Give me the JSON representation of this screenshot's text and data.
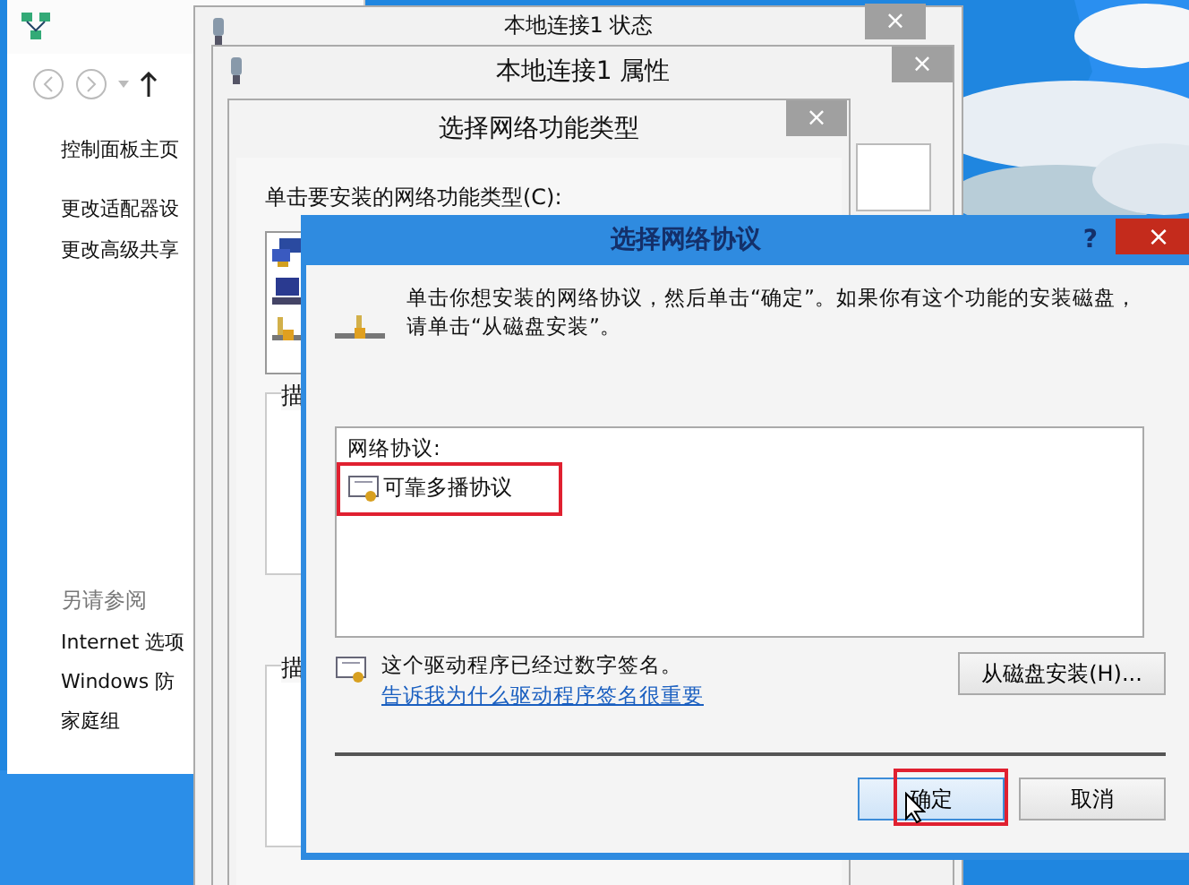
{
  "control_panel": {
    "nav": [
      {
        "kind": "back"
      },
      {
        "kind": "forward"
      },
      {
        "kind": "recent"
      },
      {
        "kind": "up"
      }
    ],
    "links": [
      "控制面板主页",
      "更改适配器设",
      "更改高级共享"
    ],
    "see_also": {
      "heading": "另请参阅",
      "links": [
        "Internet 选项",
        "Windows 防",
        "家庭组"
      ]
    }
  },
  "status_window": {
    "title": "本地连接1 状态",
    "close": "×"
  },
  "properties_window": {
    "title": "本地连接1 属性",
    "close": "×"
  },
  "feature_type_dialog": {
    "title": "选择网络功能类型",
    "close": "×",
    "prompt": "单击要安装的网络功能类型(C):",
    "types": [
      {
        "kind": "client"
      },
      {
        "kind": "service"
      },
      {
        "kind": "protocol"
      }
    ],
    "group_labels": [
      "描",
      "描"
    ]
  },
  "protocol_dialog": {
    "title": "选择网络协议",
    "help": "?",
    "close": "×",
    "instructions": "单击你想安装的网络协议，然后单击“确定”。如果你有这个功能的安装磁盘，请单击“从磁盘安装”。",
    "list_label": "网络协议:",
    "protocols": [
      {
        "name": "可靠多播协议",
        "selected": false
      }
    ],
    "signature_note": "这个驱动程序已经过数字签名。",
    "signature_link": "告诉我为什么驱动程序签名很重要",
    "buttons": [
      {
        "label": "从磁盘安装(H)...",
        "kind": "disk",
        "default": false
      },
      {
        "label": "确定",
        "kind": "ok",
        "default": true
      },
      {
        "label": "取消",
        "kind": "cancel",
        "default": false
      }
    ]
  }
}
